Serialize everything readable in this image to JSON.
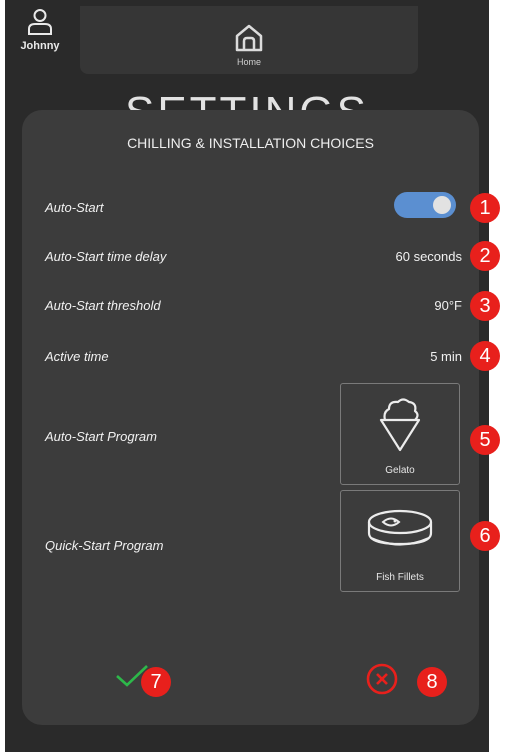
{
  "user": {
    "name": "Johnny"
  },
  "nav": {
    "home_label": "Home"
  },
  "page": {
    "title": "SETTINGS"
  },
  "dialog": {
    "title": "CHILLING & INSTALLATION CHOICES",
    "rows": {
      "auto_start": {
        "label": "Auto-Start",
        "enabled": true
      },
      "delay": {
        "label": "Auto-Start time delay",
        "value": "60 seconds"
      },
      "threshold": {
        "label": "Auto-Start threshold",
        "value": "90°F"
      },
      "active_time": {
        "label": "Active time",
        "value": "5 min"
      },
      "auto_program": {
        "label": "Auto-Start Program",
        "program": "Gelato",
        "icon": "ice-cream-cone-icon"
      },
      "quick_program": {
        "label": "Quick-Start Program",
        "program": "Fish Fillets",
        "icon": "fish-fillet-icon"
      }
    }
  },
  "colors": {
    "toggle_on": "#5b8fd1",
    "confirm": "#2db84a",
    "cancel": "#e8201c",
    "badge": "#e8201c"
  },
  "badges": [
    "1",
    "2",
    "3",
    "4",
    "5",
    "6",
    "7",
    "8"
  ]
}
